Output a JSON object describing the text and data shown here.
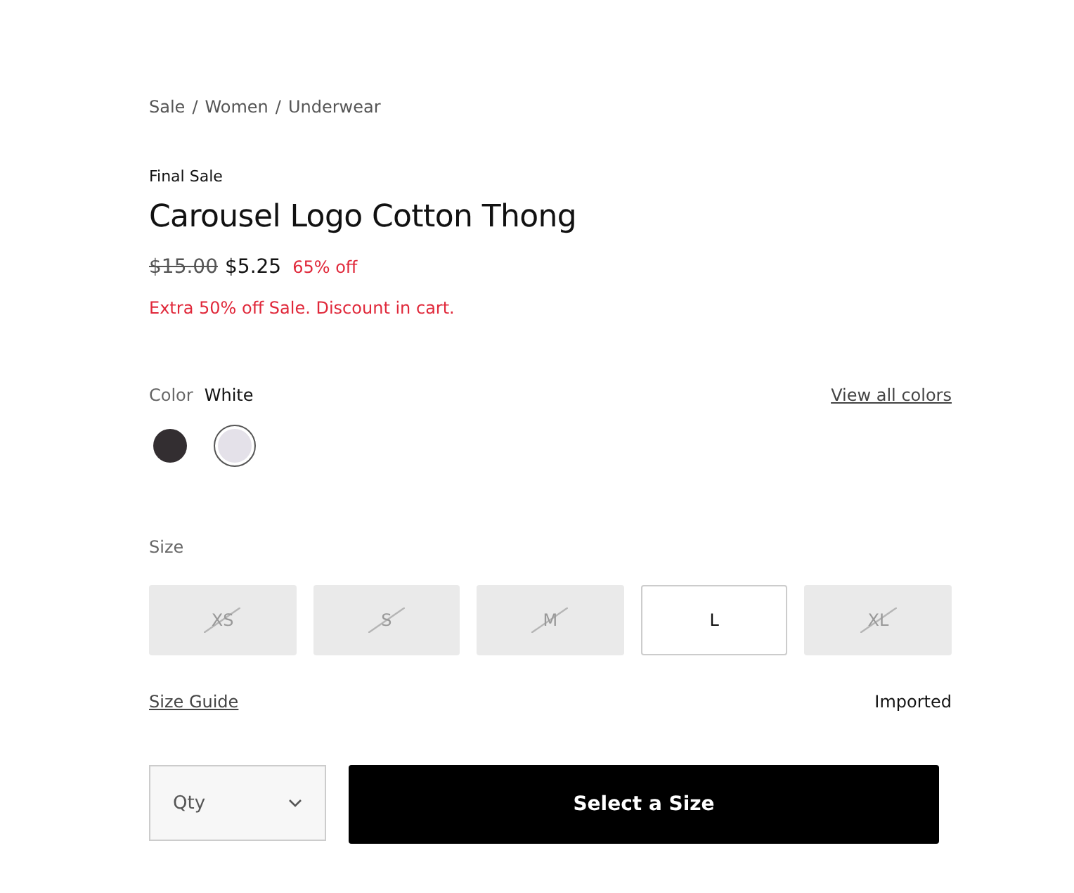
{
  "breadcrumb": [
    {
      "label": "Sale"
    },
    {
      "separator": "/",
      "label": "Women"
    },
    {
      "separator": "/",
      "label": "Underwear"
    }
  ],
  "badge": "Final Sale",
  "title": "Carousel Logo Cotton Thong",
  "price": {
    "original": "$15.00",
    "current": "$5.25",
    "discount": "65% off"
  },
  "promo": "Extra 50% off Sale. Discount in cart.",
  "color": {
    "label": "Color",
    "value": "White",
    "view_all": "View all colors",
    "swatches": [
      {
        "color": "#332e31",
        "selected": false
      },
      {
        "color": "#e4e1e9",
        "selected": true
      }
    ]
  },
  "size": {
    "label": "Size",
    "options": [
      {
        "label": "XS",
        "available": false,
        "selected": false
      },
      {
        "label": "S",
        "available": false,
        "selected": false
      },
      {
        "label": "M",
        "available": false,
        "selected": false
      },
      {
        "label": "L",
        "available": true,
        "selected": false
      },
      {
        "label": "XL",
        "available": false,
        "selected": false
      }
    ]
  },
  "size_guide": "Size Guide",
  "origin": "Imported",
  "qty": {
    "placeholder": "Qty"
  },
  "add_button": "Select a Size"
}
